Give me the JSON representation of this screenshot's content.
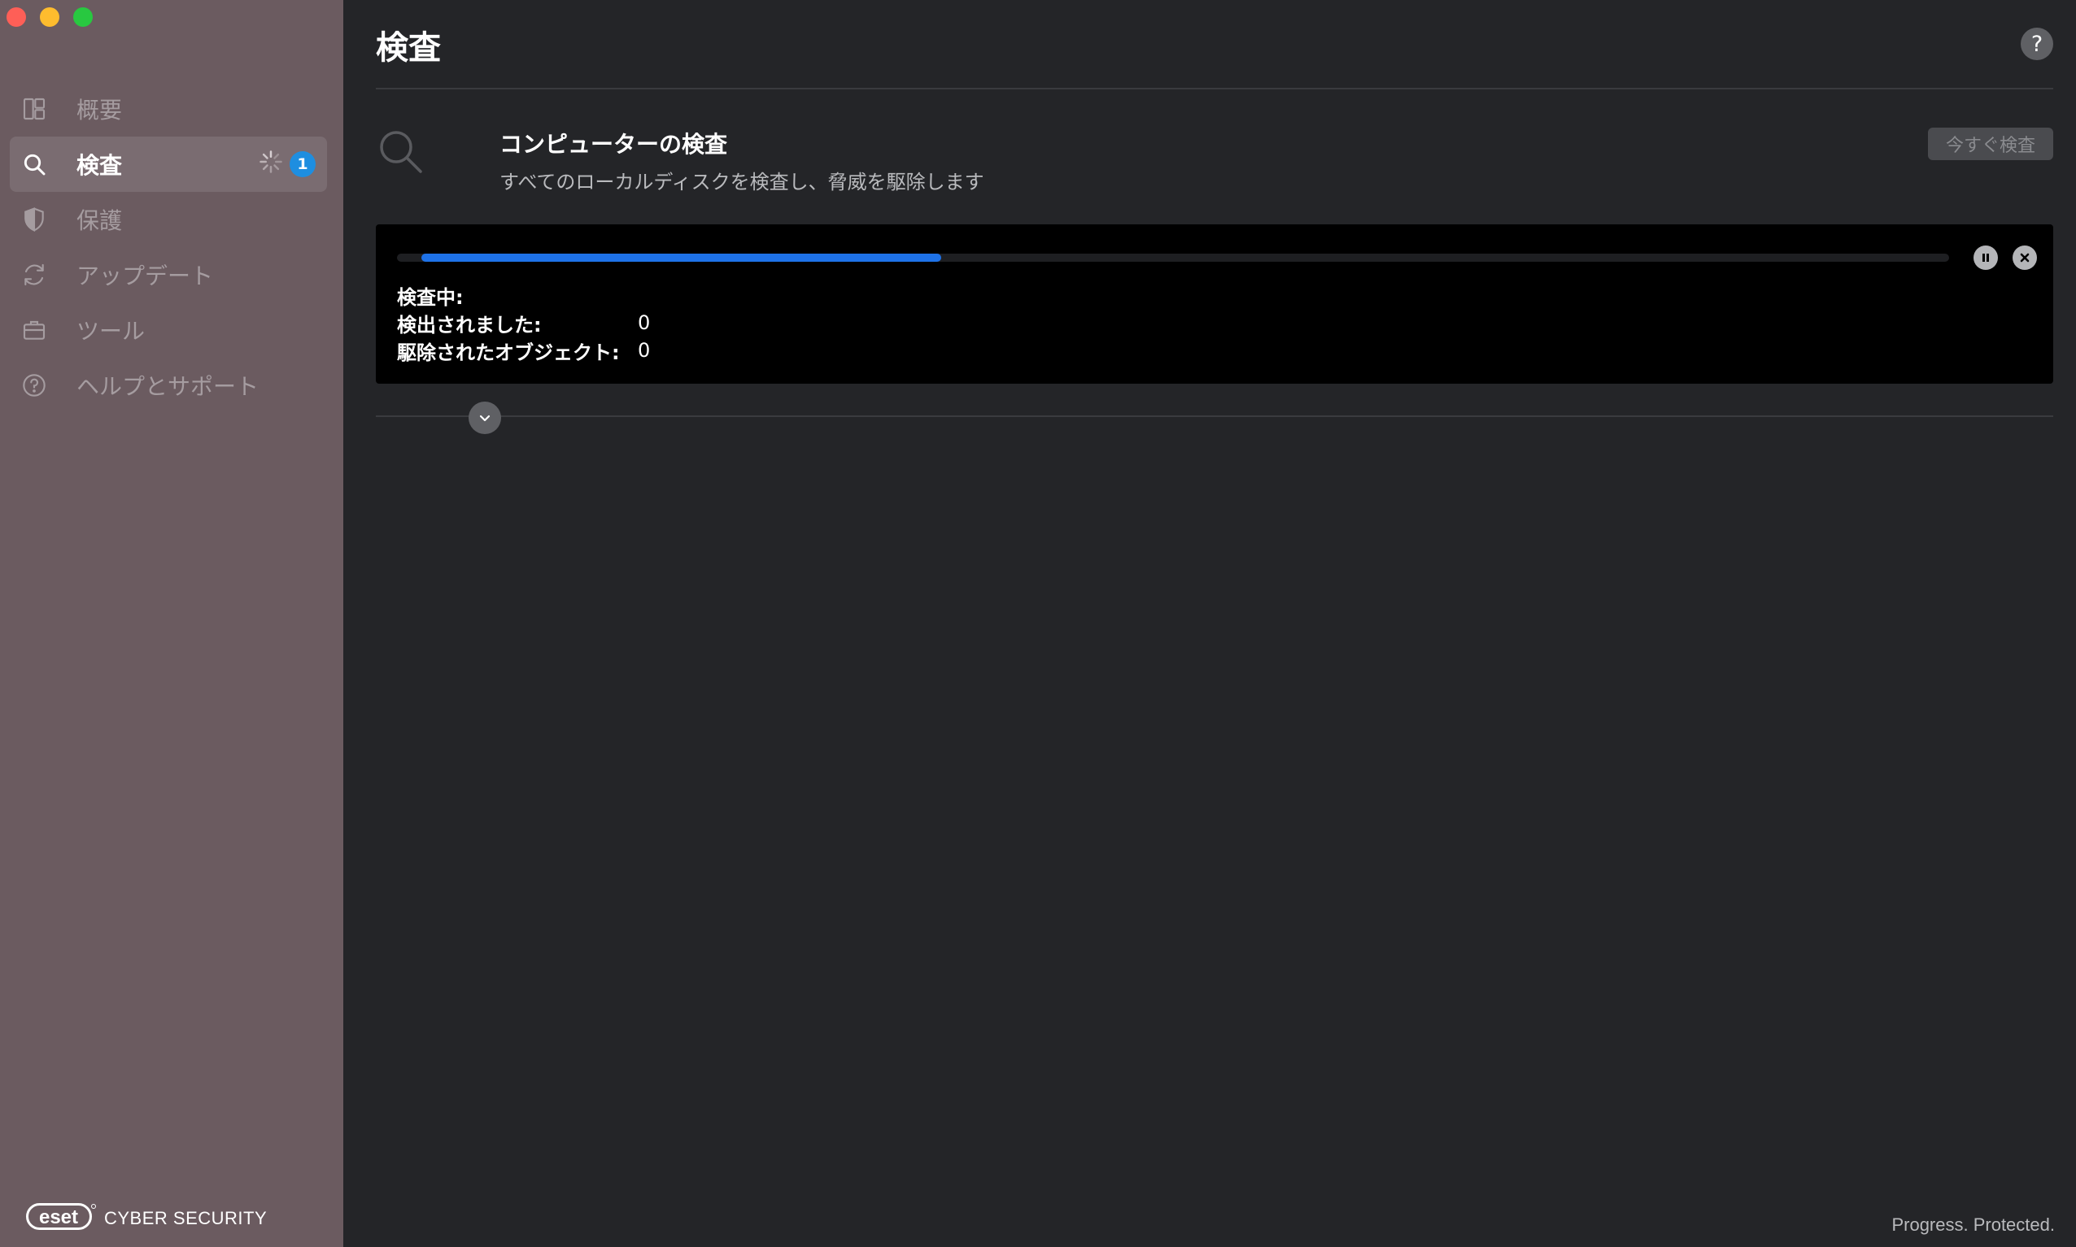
{
  "window": {
    "controls": [
      "close",
      "minimize",
      "maximize"
    ]
  },
  "sidebar": {
    "items": [
      {
        "label": "概要",
        "icon": "dashboard-icon",
        "active": false
      },
      {
        "label": "検査",
        "icon": "search-icon",
        "active": true,
        "badge": "1",
        "status_icon": "spinner-icon"
      },
      {
        "label": "保護",
        "icon": "shield-icon",
        "active": false
      },
      {
        "label": "アップデート",
        "icon": "refresh-icon",
        "active": false
      },
      {
        "label": "ツール",
        "icon": "briefcase-icon",
        "active": false
      },
      {
        "label": "ヘルプとサポート",
        "icon": "question-circle-icon",
        "active": false
      }
    ],
    "brand": {
      "logo": "eset",
      "product": "CYBER SECURITY"
    }
  },
  "header": {
    "title": "検査",
    "help_label": "?"
  },
  "scan": {
    "title": "コンピューターの検査",
    "description": "すべてのローカルディスクを検査し、脅威を駆除します",
    "scan_now_label": "今すぐ検査",
    "progress": {
      "fraction": 0.34,
      "scanning_label": "検査中:",
      "scanning_value": "",
      "detected_label": "検出されました:",
      "detected_value": "0",
      "cleaned_label": "駆除されたオブジェクト:",
      "cleaned_value": "0"
    }
  },
  "footer": {
    "slogan": "Progress. Protected."
  },
  "colors": {
    "sidebar_bg": "#6b5b60",
    "sidebar_active": "#7a6c71",
    "main_bg": "#242528",
    "progress_fill": "#1e72e8",
    "badge": "#1e8ee0"
  }
}
